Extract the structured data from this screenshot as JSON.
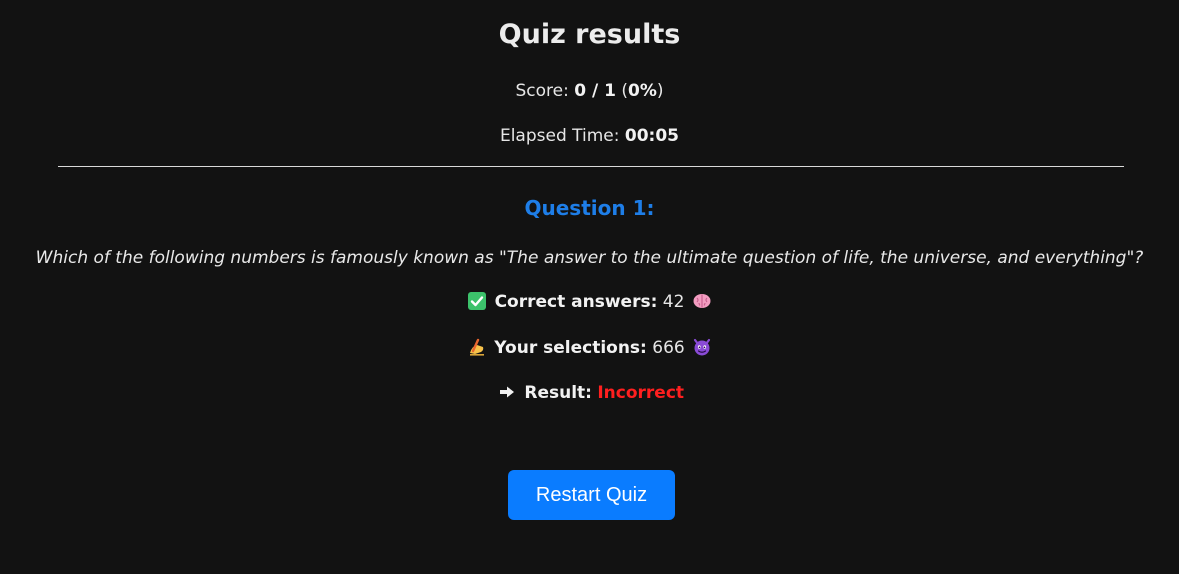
{
  "title": "Quiz results",
  "score": {
    "label": "Score: ",
    "value": "0 / 1",
    "open": " (",
    "percent": "0%",
    "close": ")"
  },
  "elapsed": {
    "label": "Elapsed Time: ",
    "value": "00:05"
  },
  "question": {
    "heading": "Question 1:",
    "text": "Which of the following numbers is famously known as \"The answer to the ultimate question of life, the universe, and everything\"?",
    "correct_label": "Correct answers:",
    "correct_value": " 42",
    "selection_label": "Your selections:",
    "selection_value": " 666",
    "result_label": "Result:",
    "result_value": "Incorrect"
  },
  "icons": {
    "correct": "check-mark-icon",
    "brain": "brain-icon",
    "writing": "writing-hand-icon",
    "devil": "smiling-devil-icon",
    "arrow": "right-arrow-icon"
  },
  "colors": {
    "background": "#121212",
    "question_heading": "#1e7ee8",
    "incorrect": "#ff1f1f",
    "button": "#0a7cff"
  },
  "restart_label": "Restart Quiz"
}
